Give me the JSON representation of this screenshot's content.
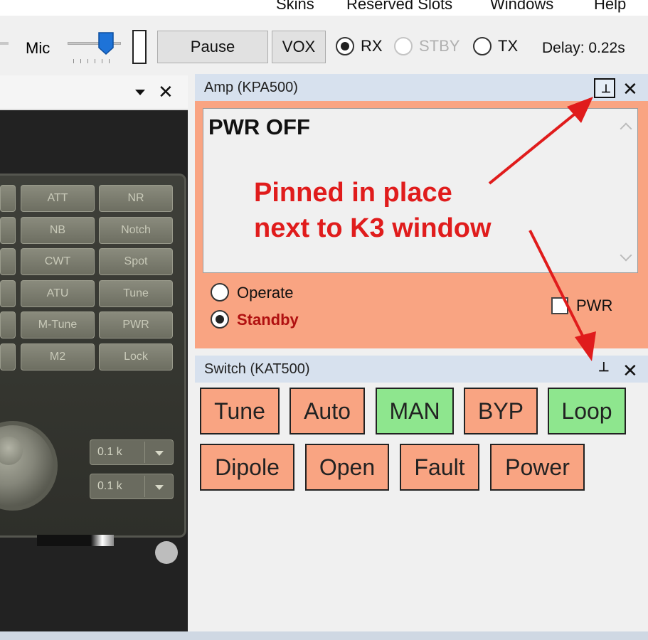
{
  "menu": {
    "items": [
      {
        "label": "Skins"
      },
      {
        "label": "Reserved Slots"
      },
      {
        "label": "Windows"
      },
      {
        "label": "Help"
      }
    ]
  },
  "toolbar": {
    "mic_label": "Mic",
    "mic_level_fraction": 0.65,
    "pause_label": "Pause",
    "vox_label": "VOX",
    "modes": [
      {
        "label": "RX",
        "checked": true,
        "enabled": true
      },
      {
        "label": "STBY",
        "checked": false,
        "enabled": false
      },
      {
        "label": "TX",
        "checked": false,
        "enabled": true
      }
    ],
    "delay": "Delay: 0.22s"
  },
  "k3_panel": {
    "buttons": [
      "ATT",
      "NR",
      "NB",
      "Notch",
      "CWT",
      "Spot",
      "ATU",
      "Tune",
      "M-Tune",
      "PWR",
      "M2",
      "Lock"
    ],
    "dropdowns": [
      "0.1 k",
      "0.1 k"
    ]
  },
  "amp_panel": {
    "title": "Amp (KPA500)",
    "display_text": "PWR OFF",
    "options": [
      {
        "label": "Operate",
        "checked": false
      },
      {
        "label": "Standby",
        "checked": true
      }
    ],
    "pwr_label": "PWR"
  },
  "annotation": {
    "line1": "Pinned in place",
    "line2": "next to K3 window",
    "color": "#e01c1c"
  },
  "switch_panel": {
    "title": "Switch (KAT500)",
    "row1": [
      {
        "label": "Tune",
        "state": "salmon"
      },
      {
        "label": "Auto",
        "state": "salmon"
      },
      {
        "label": "MAN",
        "state": "green"
      },
      {
        "label": "BYP",
        "state": "salmon"
      },
      {
        "label": "Loop",
        "state": "green"
      }
    ],
    "row2": [
      {
        "label": "Dipole",
        "state": "salmon"
      },
      {
        "label": "Open",
        "state": "salmon"
      },
      {
        "label": "Fault",
        "state": "salmon"
      },
      {
        "label": "Power",
        "state": "salmon"
      }
    ]
  },
  "colors": {
    "amp_background": "#f9a482",
    "button_active": "#8ee68e",
    "button_inactive": "#f9a482",
    "panel_header": "#d7e1ee"
  }
}
